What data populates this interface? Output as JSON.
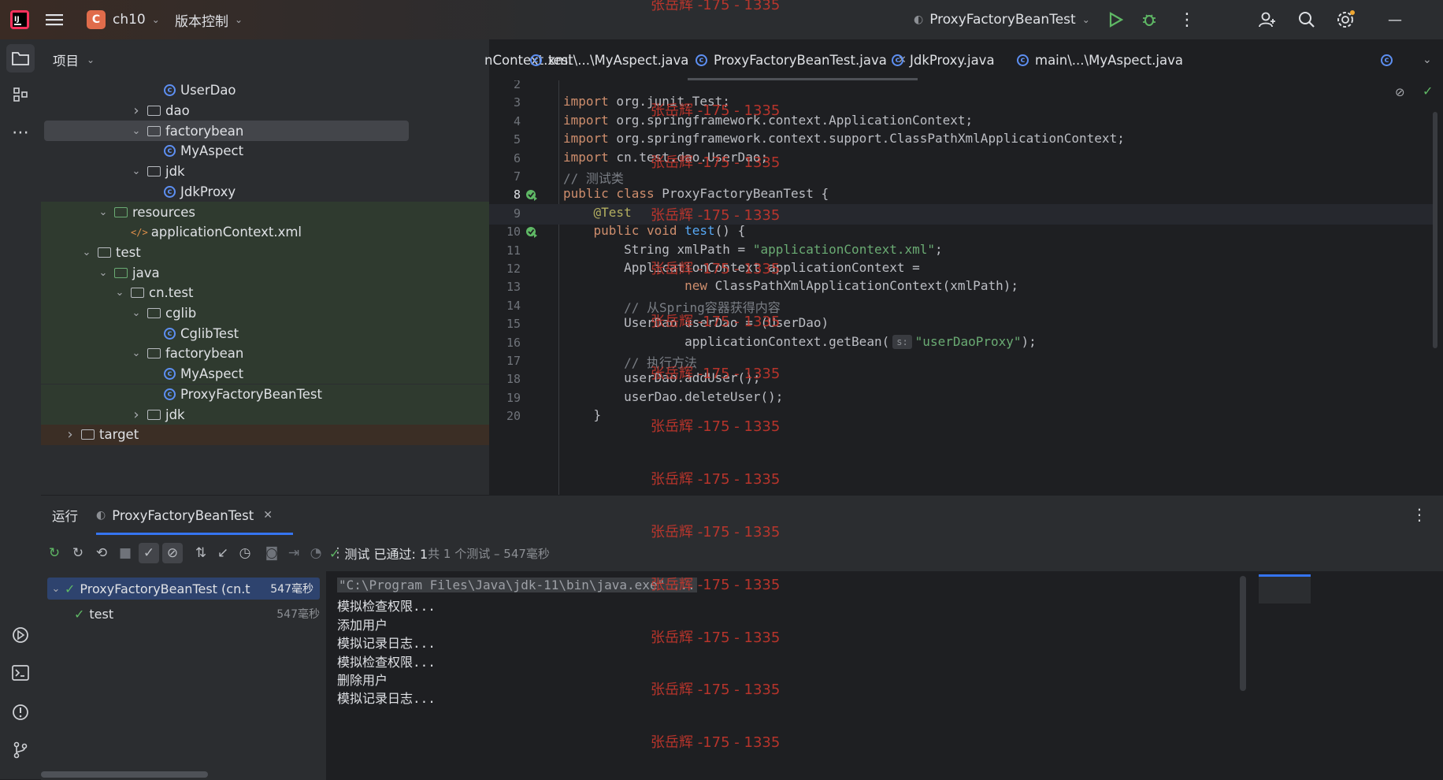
{
  "titlebar": {
    "project_badge": "C",
    "project_name": "ch10",
    "vcs_label": "版本控制",
    "run_config": "ProxyFactoryBeanTest"
  },
  "project_panel": {
    "title": "项目",
    "tree": [
      {
        "label": "UserDao",
        "kind": "class",
        "level": 4,
        "expanded": null,
        "selected": false
      },
      {
        "label": "dao",
        "kind": "package",
        "level": 3,
        "expanded": false,
        "selected": false
      },
      {
        "label": "factorybean",
        "kind": "package",
        "level": 3,
        "expanded": true,
        "selected": true
      },
      {
        "label": "MyAspect",
        "kind": "class",
        "level": 4,
        "expanded": null,
        "selected": false
      },
      {
        "label": "jdk",
        "kind": "package",
        "level": 3,
        "expanded": true,
        "selected": false
      },
      {
        "label": "JdkProxy",
        "kind": "class",
        "level": 4,
        "expanded": null,
        "selected": false
      },
      {
        "label": "resources",
        "kind": "resources",
        "level": 1,
        "expanded": true,
        "selected": false
      },
      {
        "label": "applicationContext.xml",
        "kind": "xml",
        "level": 2,
        "expanded": null,
        "selected": false
      },
      {
        "label": "test",
        "kind": "folder",
        "level": 0,
        "expanded": true,
        "selected": false
      },
      {
        "label": "java",
        "kind": "testfolder",
        "level": 1,
        "expanded": true,
        "selected": false
      },
      {
        "label": "cn.test",
        "kind": "package",
        "level": 2,
        "expanded": true,
        "selected": false
      },
      {
        "label": "cglib",
        "kind": "package",
        "level": 3,
        "expanded": true,
        "selected": false
      },
      {
        "label": "CglibTest",
        "kind": "class",
        "level": 4,
        "expanded": null,
        "selected": false
      },
      {
        "label": "factorybean",
        "kind": "package",
        "level": 3,
        "expanded": true,
        "selected": false
      },
      {
        "label": "MyAspect",
        "kind": "class",
        "level": 4,
        "expanded": null,
        "selected": false
      },
      {
        "label": "ProxyFactoryBeanTest",
        "kind": "class",
        "level": 4,
        "expanded": null,
        "selected": false
      },
      {
        "label": "jdk",
        "kind": "package",
        "level": 3,
        "expanded": false,
        "selected": false
      },
      {
        "label": "target",
        "kind": "folder",
        "level": -1,
        "expanded": false,
        "selected": false
      }
    ]
  },
  "editor": {
    "tabs": [
      {
        "label": "nContext.xml",
        "icon": "xml-icon",
        "active": false
      },
      {
        "label": "test\\...\\MyAspect.java",
        "icon": "class-icon",
        "active": false
      },
      {
        "label": "ProxyFactoryBeanTest.java",
        "icon": "class-icon",
        "active": true
      },
      {
        "label": "JdkProxy.java",
        "icon": "class-icon",
        "active": false
      },
      {
        "label": "main\\...\\MyAspect.java",
        "icon": "class-icon",
        "active": false
      }
    ],
    "lines": [
      {
        "n": "2",
        "html": ""
      },
      {
        "n": "3",
        "html": "<span class=\"kw\">import</span> org.junit.Test;"
      },
      {
        "n": "4",
        "html": "<span class=\"kw\">import</span> org.springframework.context.ApplicationContext;"
      },
      {
        "n": "5",
        "html": "<span class=\"kw\">import</span> org.springframework.context.support.ClassPathXmlApplicationContext;"
      },
      {
        "n": "6",
        "html": "<span class=\"kw\">import</span> cn.test.dao.UserDao;"
      },
      {
        "n": "7",
        "html": "<span class=\"cmt\">// 测试类</span>"
      },
      {
        "n": "8",
        "html": "<span class=\"kw\">public class</span> ProxyFactoryBeanTest {"
      },
      {
        "n": "9",
        "html": "    <span class=\"ann\">@Test</span>"
      },
      {
        "n": "10",
        "html": "    <span class=\"kw\">public void</span> <span class=\"fn\">test</span>() {"
      },
      {
        "n": "11",
        "html": "        String xmlPath = <span class=\"str\">\"applicationContext.xml\"</span>;"
      },
      {
        "n": "12",
        "html": "        ApplicationContext applicationContext ="
      },
      {
        "n": "13",
        "html": "                <span class=\"kw\">new</span> ClassPathXmlApplicationContext(xmlPath);"
      },
      {
        "n": "14",
        "html": "        <span class=\"cmt\">// 从Spring容器获得内容</span>"
      },
      {
        "n": "15",
        "html": "        UserDao userDao = (UserDao)"
      },
      {
        "n": "16",
        "html": "                applicationContext.getBean(<span class=\"hint\">s:</span><span class=\"str\">\"userDaoProxy\"</span>);"
      },
      {
        "n": "17",
        "html": "        <span class=\"cmt\">// 执行方法</span>"
      },
      {
        "n": "18",
        "html": "        userDao.addUser();"
      },
      {
        "n": "19",
        "html": "        userDao.deleteUser();"
      },
      {
        "n": "20",
        "html": "    }"
      }
    ]
  },
  "run_panel": {
    "title": "运行",
    "tab_label": "ProxyFactoryBeanTest",
    "status_prefix": "测试 已通过: 1",
    "status_detail": "共 1 个测试 – 547毫秒",
    "tests": [
      {
        "label": "ProxyFactoryBeanTest (cn.t",
        "time": "547毫秒",
        "selected": true
      },
      {
        "label": "test",
        "time": "547毫秒",
        "selected": false
      }
    ],
    "console": [
      "\"C:\\Program Files\\Java\\jdk-11\\bin\\java.exe\" ...",
      "模拟检查权限...",
      "添加用户",
      "模拟记录日志...",
      "模拟检查权限...",
      "删除用户",
      "模拟记录日志..."
    ]
  },
  "watermark": "张岳辉 -175 - 1335",
  "colors": {
    "accent": "#3574f0",
    "pass": "#5fb865",
    "keyword": "#cf8e6d",
    "string": "#6aab73",
    "watermark": "#c8372d"
  }
}
